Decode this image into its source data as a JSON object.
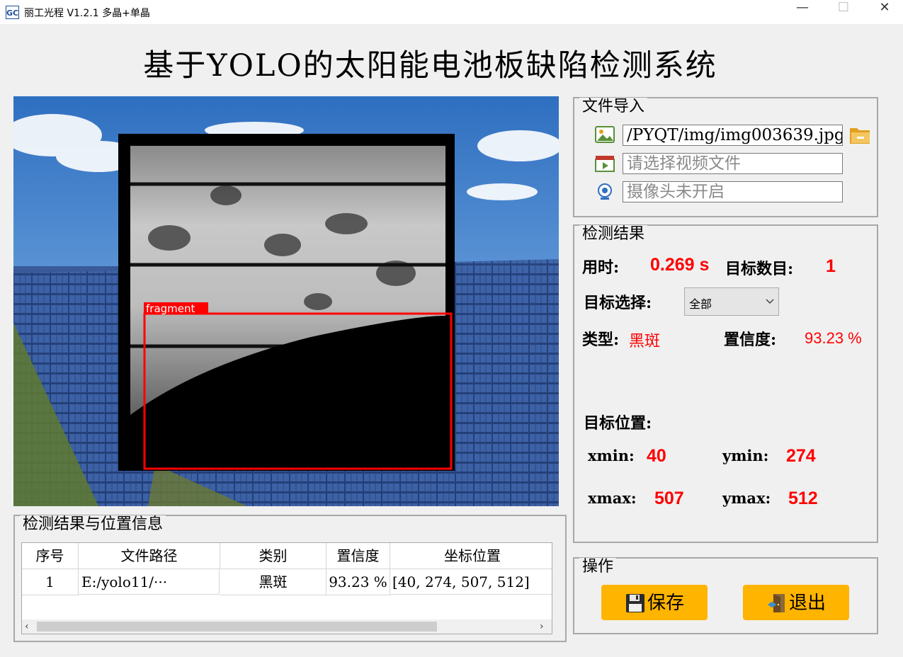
{
  "window": {
    "logo": "GC",
    "title": "丽工光程 V1.2.1 多晶+单晶",
    "minimize": "—",
    "maximize": "☐",
    "close": "✕"
  },
  "header": {
    "title": "基于YOLO的太阳能电池板缺陷检测系统"
  },
  "image_view": {
    "detection_label": "fragment"
  },
  "file_import": {
    "legend": "文件导入",
    "image_path": "/PYQT/img/img003639.jpg",
    "video_placeholder": "请选择视频文件",
    "camera_placeholder": "摄像头未开启"
  },
  "results": {
    "legend": "检测结果",
    "time_label": "用时:",
    "time_value": "0.269 s",
    "count_label": "目标数目:",
    "count_value": "1",
    "select_label": "目标选择:",
    "select_value": "全部",
    "type_label": "类型:",
    "type_value": "黑斑",
    "confidence_label": "置信度:",
    "confidence_value": "93.23 %",
    "position_label": "目标位置:",
    "xmin_label": "xmin:",
    "xmin_value": "40",
    "ymin_label": "ymin:",
    "ymin_value": "274",
    "xmax_label": "xmax:",
    "xmax_value": "507",
    "ymax_label": "ymax:",
    "ymax_value": "512"
  },
  "table": {
    "legend": "检测结果与位置信息",
    "columns": [
      "序号",
      "文件路径",
      "类别",
      "置信度",
      "坐标位置"
    ],
    "rows": [
      [
        "1",
        "E:/yolo11/···",
        "黑斑",
        "93.23 %",
        "[40, 274, 507, 512]"
      ]
    ]
  },
  "actions": {
    "legend": "操作",
    "save_label": "保存",
    "exit_label": "退出"
  },
  "colors": {
    "accent_button": "#ffb400",
    "result_red": "#ff0000",
    "box_red": "#ff0000"
  }
}
